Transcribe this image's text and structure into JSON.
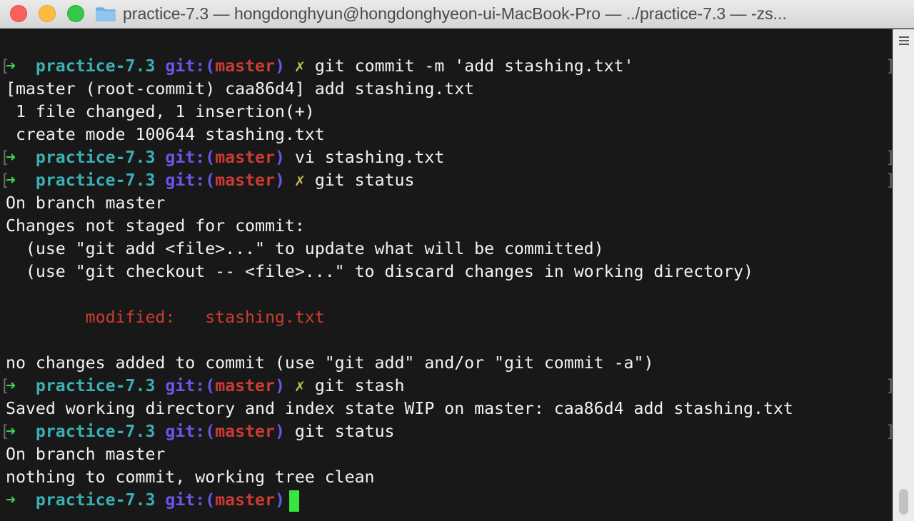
{
  "window": {
    "title": "practice-7.3 — hongdonghyun@hongdonghyeon-ui-MacBook-Pro — ../practice-7.3 — -zs..."
  },
  "prompt": {
    "arrow": "➜",
    "dir": "practice-7.3",
    "git": "git:(",
    "branch": "master",
    "close": ")",
    "dirty": "✗"
  },
  "terminal": {
    "cmd1": "git commit -m 'add stashing.txt'",
    "out1": "[master (root-commit) caa86d4] add stashing.txt",
    "out2": " 1 file changed, 1 insertion(+)",
    "out3": " create mode 100644 stashing.txt",
    "cmd2": "vi stashing.txt",
    "cmd3": "git status",
    "out4": "On branch master",
    "out5": "Changes not staged for commit:",
    "out6": "  (use \"git add <file>...\" to update what will be committed)",
    "out7": "  (use \"git checkout -- <file>...\" to discard changes in working directory)",
    "out8": "        modified:   stashing.txt",
    "out9": "no changes added to commit (use \"git add\" and/or \"git commit -a\")",
    "cmd4": "git stash",
    "out10": "Saved working directory and index state WIP on master: caa86d4 add stashing.txt",
    "cmd5": "git status",
    "out11": "On branch master",
    "out12": "nothing to commit, working tree clean"
  },
  "colors": {
    "arrow": "#3fcf4f",
    "dir": "#39b0b6",
    "git": "#6a56e8",
    "branch": "#cc3b33",
    "dirty": "#c8c050",
    "cursor": "#39e63e"
  }
}
